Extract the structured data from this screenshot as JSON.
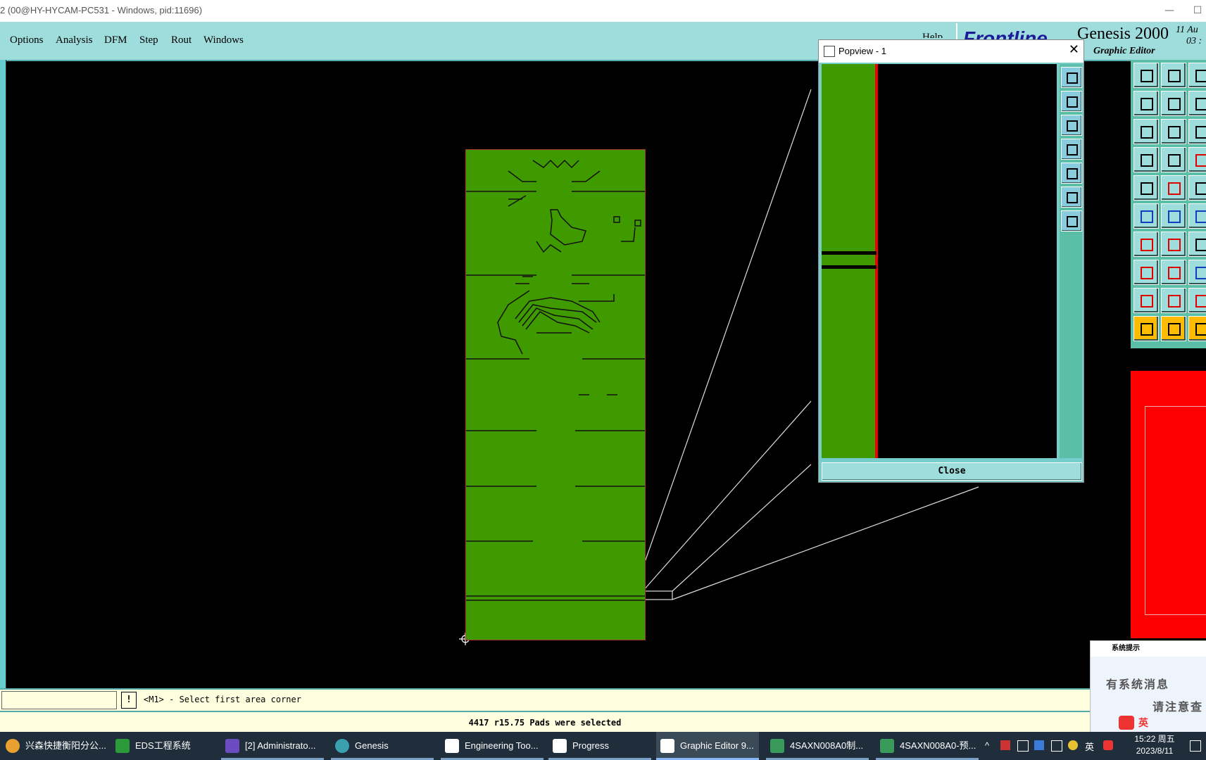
{
  "window": {
    "title": "2 (00@HY-HYCAM-PC531 - Windows, pid:11696)",
    "minimize": "—",
    "maximize": "☐"
  },
  "menu": {
    "items": [
      "Options",
      "Analysis",
      "DFM",
      "Step",
      "Rout",
      "Windows"
    ],
    "help": "Help"
  },
  "brand": {
    "logo": "Frontline",
    "product": "Genesis 2000",
    "subtitle": "Graphic Editor",
    "date": "11 Au",
    "time": "03 :"
  },
  "popview": {
    "title": "Popview - 1",
    "close_label": "Close",
    "close_x": "✕"
  },
  "prompt": {
    "bang": "!",
    "text": "<M1> - Select first area corner"
  },
  "status": {
    "text": "4417 r15.75 Pads were selected"
  },
  "sysmsg": {
    "header": "系统提示",
    "line1": "有系统消息",
    "line2": "请注意查",
    "ime_label": "英"
  },
  "taskbar": {
    "items": [
      {
        "label": "兴森快捷衡阳分公...",
        "color": "#e8a030"
      },
      {
        "label": "EDS工程系统",
        "color": "#2a9a3a"
      },
      {
        "label": "[2] Administrato...",
        "color": "#6a4bc0"
      },
      {
        "label": "Genesis",
        "color": "#3aa0b0"
      },
      {
        "label": "Engineering Too...",
        "color": "#ffffff"
      },
      {
        "label": "Progress",
        "color": "#ffffff"
      },
      {
        "label": "Graphic Editor 9...",
        "color": "#ffffff"
      },
      {
        "label": "4SAXN008A0制...",
        "color": "#3a9a5a"
      },
      {
        "label": "4SAXN008A0-预...",
        "color": "#3a9a5a"
      }
    ],
    "tray": {
      "lang": "英",
      "time": "15:22 周五",
      "date": "2023/8/11"
    }
  },
  "colors": {
    "board": "#3f9a00",
    "panel": "#9fdcdc",
    "toolbox": "#5bbfa8",
    "prompt_bg": "#ffffe0",
    "taskbar": "#1f2e3a"
  }
}
